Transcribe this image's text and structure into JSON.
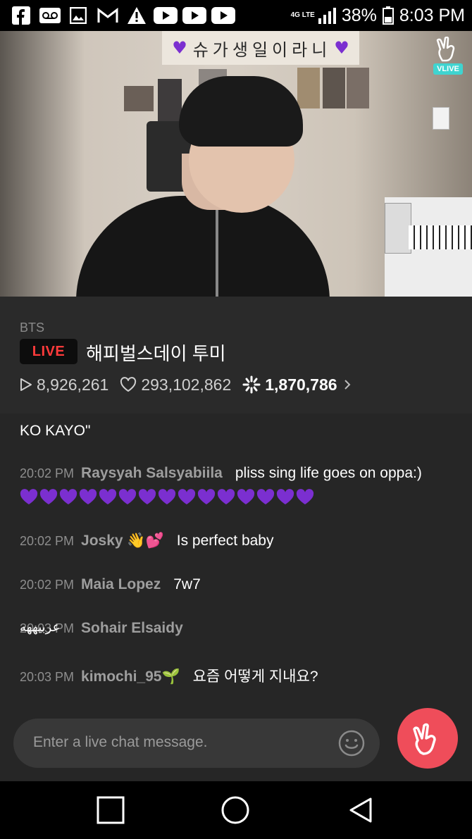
{
  "status_bar": {
    "network": "4G LTE",
    "battery": "38%",
    "time": "8:03 PM",
    "notification_icons": [
      "facebook-icon",
      "voicemail-icon",
      "gallery-icon",
      "gmail-icon",
      "warning-icon",
      "youtube-icon",
      "youtube-icon",
      "youtube-icon"
    ]
  },
  "video": {
    "banner_text": "슈가생일이라니",
    "logo_text": "VLIVE"
  },
  "broadcast": {
    "artist": "BTS",
    "live_label": "LIVE",
    "title": "해피벌스데이 투미",
    "views": "8,926,261",
    "likes": "293,102,862",
    "boosts": "1,870,786"
  },
  "chat": {
    "partial_text": "KO KAYO\"",
    "messages": [
      {
        "time": "20:02 PM",
        "user": "Raysyah Salsyabiila",
        "text": "pliss sing life goes on oppa:)",
        "heart_count": 15
      },
      {
        "time": "20:02 PM",
        "user": "Josky 👋💕",
        "text": "Is perfect baby"
      },
      {
        "time": "20:02 PM",
        "user": "Maia Lopez",
        "text": "7w7"
      },
      {
        "time": "20:03 PM",
        "user": "Sohair Elsaidy",
        "overlay_text": "عربيههه"
      },
      {
        "time": "20:03 PM",
        "user": "kimochi_95🌱",
        "text": "요즘 어떻게 지내요?"
      }
    ]
  },
  "input": {
    "placeholder": "Enter a live chat message."
  },
  "colors": {
    "accent_red": "#ef4d5a",
    "live_red": "#ff3b3b",
    "heart_purple": "#7b2fd0",
    "vlive_teal": "#3fd4d0"
  }
}
